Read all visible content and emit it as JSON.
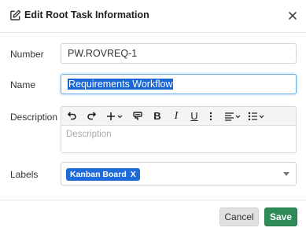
{
  "dialog": {
    "title": "Edit Root Task Information",
    "icons": {
      "title_icon": "edit-icon",
      "close": "close-icon"
    }
  },
  "form": {
    "number": {
      "label": "Number",
      "value": "PW.ROVREQ-1"
    },
    "name": {
      "label": "Name",
      "value": "Requirements Workflow"
    },
    "description": {
      "label": "Description",
      "placeholder": "Description",
      "toolbar": [
        "undo-icon",
        "redo-icon",
        "insert-plus-icon",
        "format-painter-icon",
        "bold-icon",
        "italic-icon",
        "underline-icon",
        "more-vertical-icon",
        "align-dropdown-icon",
        "list-dropdown-icon"
      ],
      "bold_glyph": "B",
      "italic_glyph": "I",
      "underline_glyph": "U"
    },
    "labels": {
      "label": "Labels",
      "chips": [
        {
          "text": "Kanban Board",
          "remove": "X"
        }
      ]
    }
  },
  "footer": {
    "cancel_label": "Cancel",
    "save_label": "Save"
  },
  "colors": {
    "save": "#2e8b57",
    "chip": "#1f6bd9",
    "selection": "#1a66d6",
    "focus": "#66afe9"
  }
}
